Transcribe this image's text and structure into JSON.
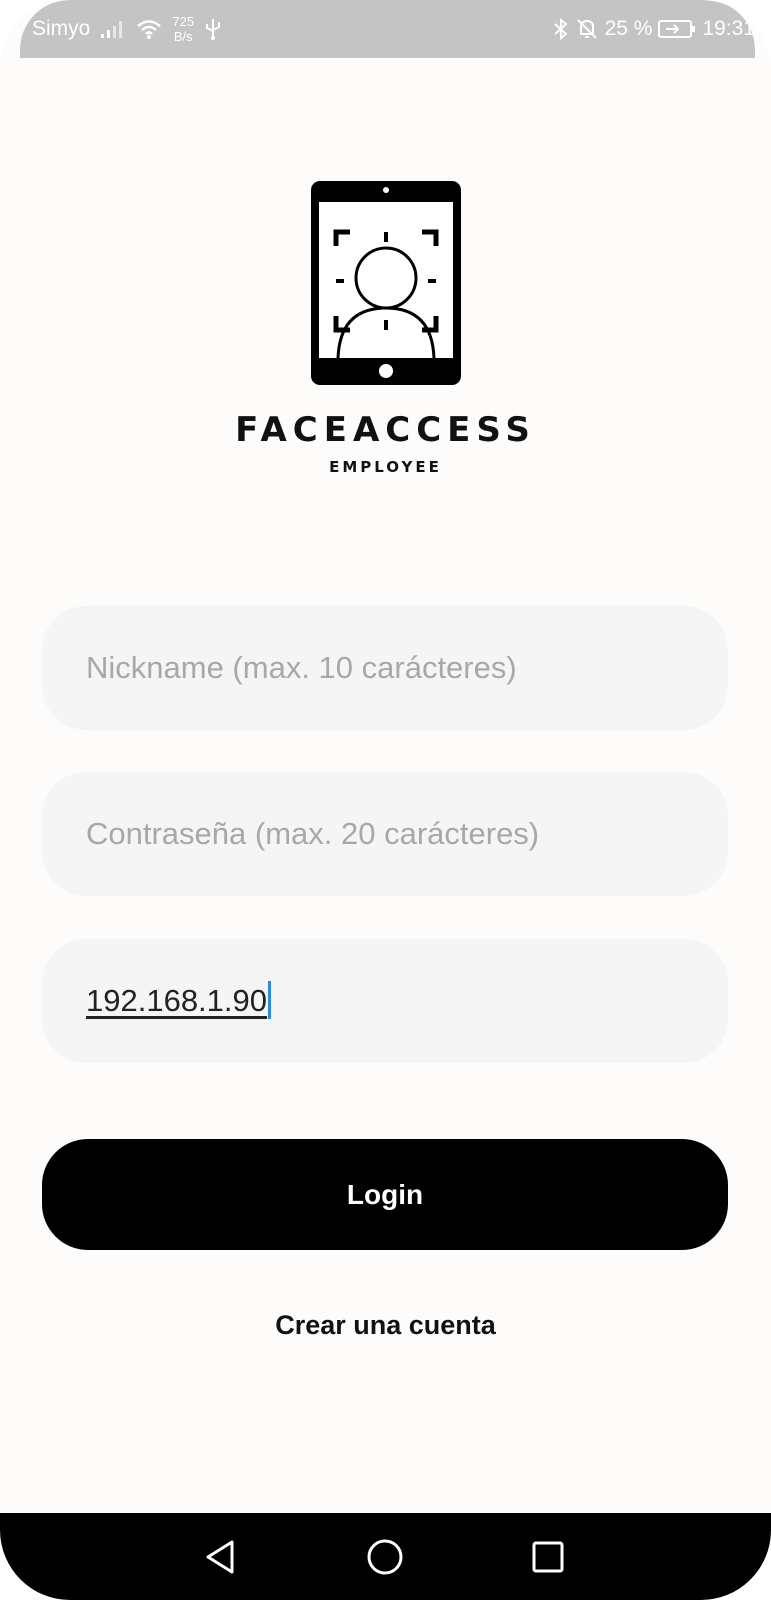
{
  "status_bar": {
    "carrier": "Simyo",
    "net_speed_value": "725",
    "net_speed_unit": "B/s",
    "battery_percent": "25 %",
    "time": "19:31",
    "icons": [
      "signal-icon",
      "wifi-icon",
      "usb-icon",
      "bluetooth-icon",
      "mute-bell-icon",
      "battery-charging-icon"
    ]
  },
  "logo": {
    "title": "FACEACCESS",
    "subtitle": "EMPLOYEE",
    "icon": "face-scan-tablet-icon"
  },
  "form": {
    "nickname_placeholder": "Nickname (max. 10 carácteres)",
    "nickname_value": "",
    "password_placeholder": "Contraseña (max. 20 carácteres)",
    "password_value": "",
    "server_ip_value": "192.168.1.90"
  },
  "actions": {
    "login_label": "Login",
    "create_account_label": "Crear una cuenta"
  },
  "nav_bar": {
    "icons": [
      "back-icon",
      "home-icon",
      "recents-icon"
    ]
  }
}
